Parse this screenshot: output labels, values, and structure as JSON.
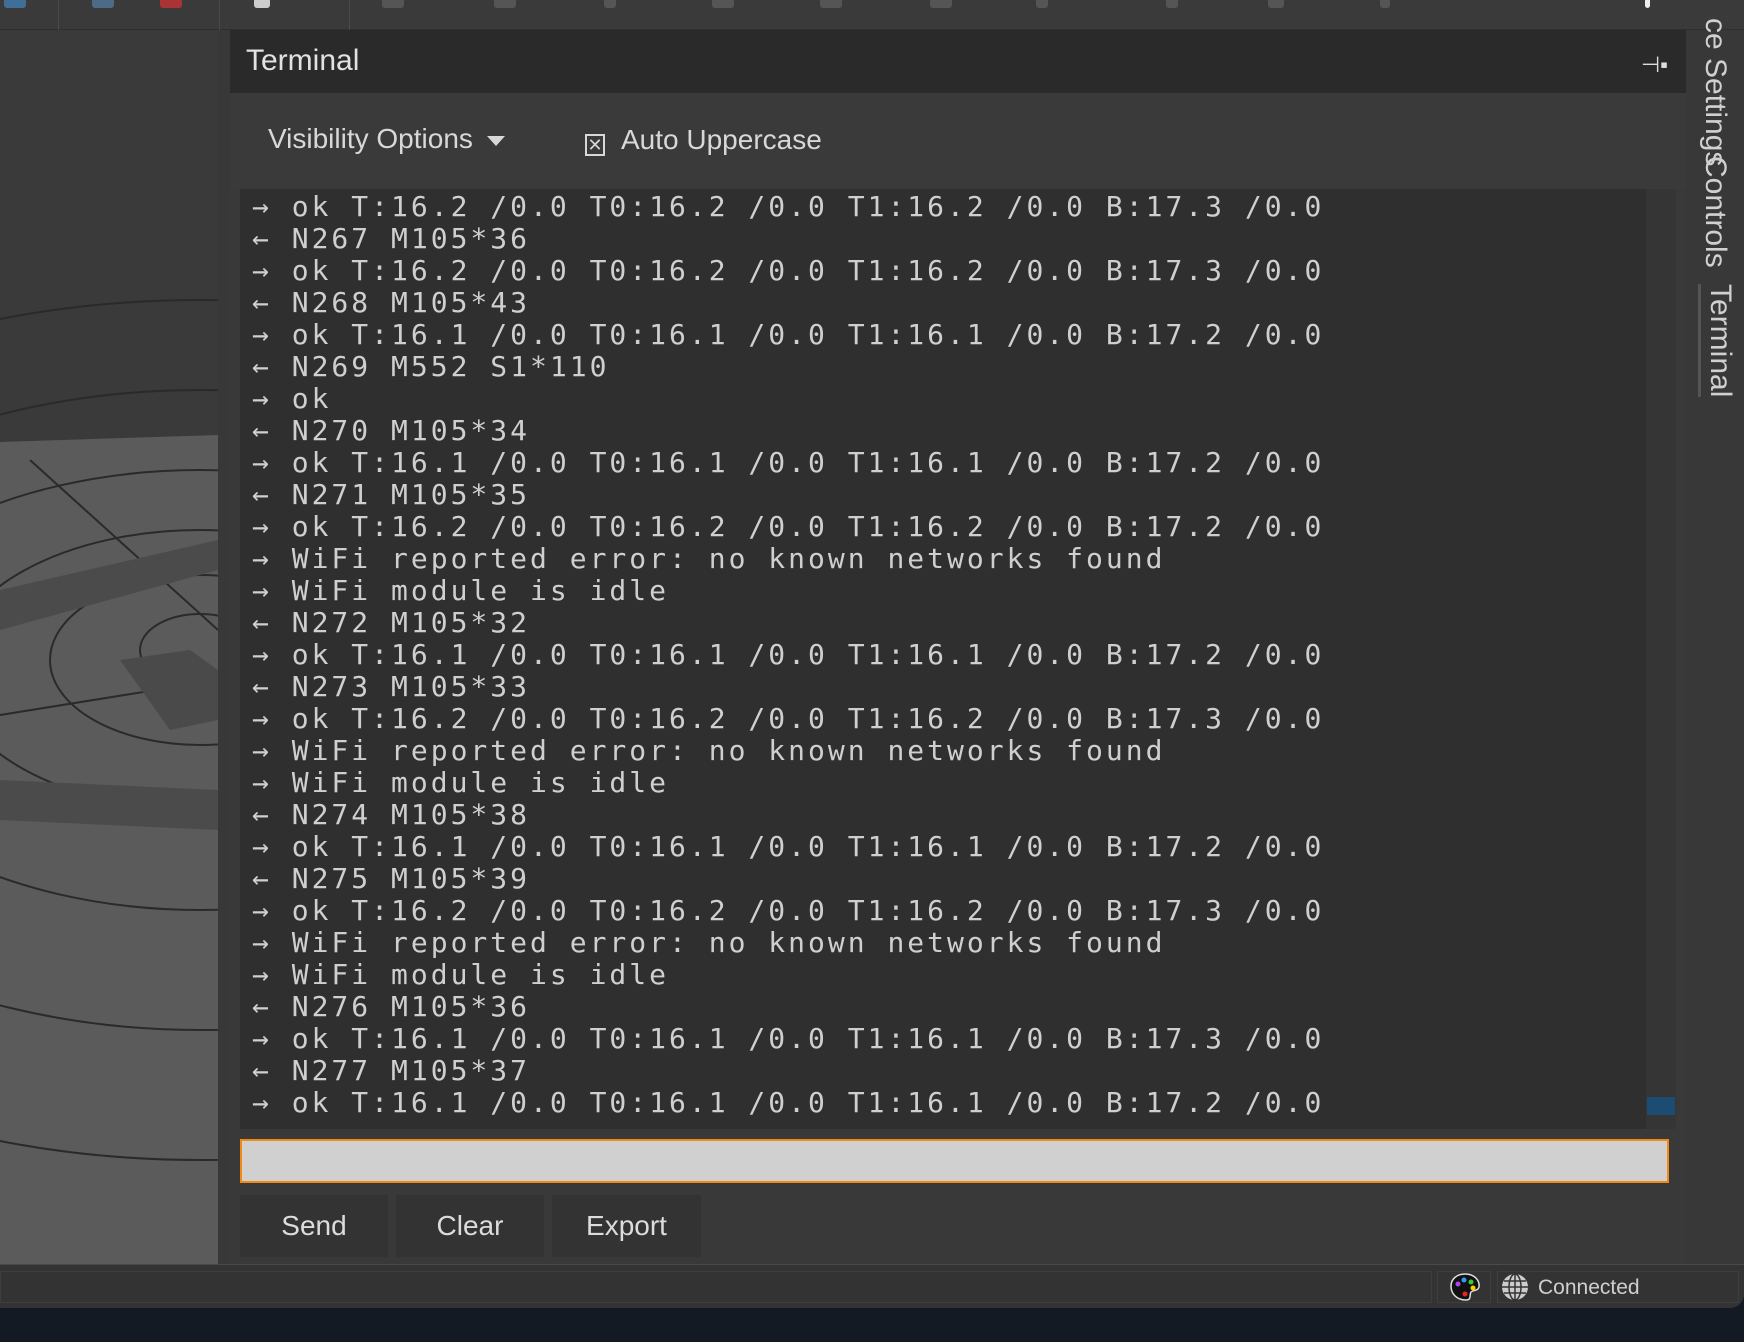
{
  "panel": {
    "title": "Terminal",
    "pin_icon": "pin-icon"
  },
  "controls": {
    "visibility_label": "Visibility Options",
    "auto_uppercase_label": "Auto Uppercase",
    "auto_uppercase_checked": true
  },
  "log": [
    "→ ok T:16.2 /0.0 T0:16.2 /0.0 T1:16.2 /0.0 B:17.3 /0.0",
    "← N267 M105*36",
    "→ ok T:16.2 /0.0 T0:16.2 /0.0 T1:16.2 /0.0 B:17.3 /0.0",
    "← N268 M105*43",
    "→ ok T:16.1 /0.0 T0:16.1 /0.0 T1:16.1 /0.0 B:17.2 /0.0",
    "← N269 M552 S1*110",
    "→ ok",
    "← N270 M105*34",
    "→ ok T:16.1 /0.0 T0:16.1 /0.0 T1:16.1 /0.0 B:17.2 /0.0",
    "← N271 M105*35",
    "→ ok T:16.2 /0.0 T0:16.2 /0.0 T1:16.2 /0.0 B:17.2 /0.0",
    "→ WiFi reported error: no known networks found",
    "→ WiFi module is idle",
    "← N272 M105*32",
    "→ ok T:16.1 /0.0 T0:16.1 /0.0 T1:16.1 /0.0 B:17.2 /0.0",
    "← N273 M105*33",
    "→ ok T:16.2 /0.0 T0:16.2 /0.0 T1:16.2 /0.0 B:17.3 /0.0",
    "→ WiFi reported error: no known networks found",
    "→ WiFi module is idle",
    "← N274 M105*38",
    "→ ok T:16.1 /0.0 T0:16.1 /0.0 T1:16.1 /0.0 B:17.2 /0.0",
    "← N275 M105*39",
    "→ ok T:16.2 /0.0 T0:16.2 /0.0 T1:16.2 /0.0 B:17.3 /0.0",
    "→ WiFi reported error: no known networks found",
    "→ WiFi module is idle",
    "← N276 M105*36",
    "→ ok T:16.1 /0.0 T0:16.1 /0.0 T1:16.1 /0.0 B:17.3 /0.0",
    "← N277 M105*37",
    "→ ok T:16.1 /0.0 T0:16.1 /0.0 T1:16.1 /0.0 B:17.2 /0.0"
  ],
  "input": {
    "value": "",
    "accent_color": "#f08a12"
  },
  "buttons": {
    "send": "Send",
    "clear": "Clear",
    "export": "Export"
  },
  "right_tabs": [
    {
      "label": "ce Settings",
      "active": false
    },
    {
      "label": "Controls",
      "active": false
    },
    {
      "label": "Terminal",
      "active": true
    }
  ],
  "status": {
    "connection": "Connected",
    "palette_icon": "palette-icon",
    "globe_icon": "globe-icon"
  }
}
